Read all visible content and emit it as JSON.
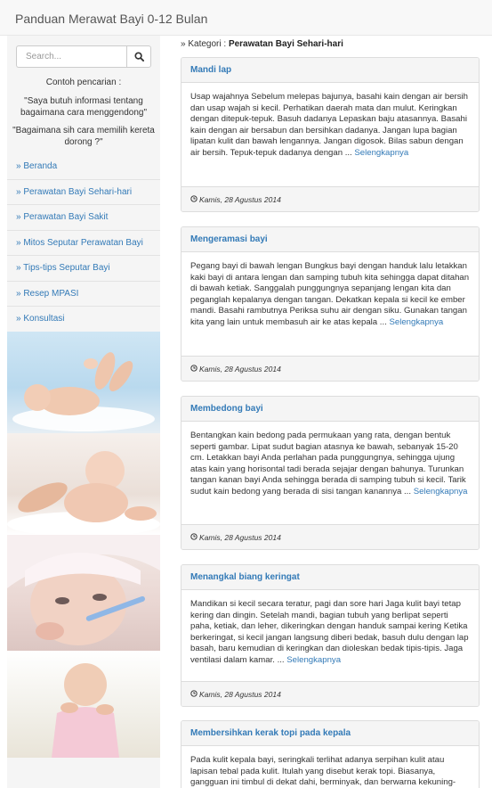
{
  "brand": "Panduan Merawat Bayi 0-12 Bulan",
  "search": {
    "placeholder": "Search...",
    "hint_title": "Contoh pencarian :",
    "examples": [
      "\"Saya butuh informasi tentang bagaimana cara menggendong\"",
      "\"Bagaimana sih cara memilih kereta dorong ?\""
    ]
  },
  "sidebar": {
    "items": [
      "» Beranda",
      "» Perawatan Bayi Sehari-hari",
      "» Perawatan Bayi Sakit",
      "» Mitos Seputar Perawatan Bayi",
      "» Tips-tips Seputar Bayi",
      "» Resep MPASI",
      "» Konsultasi"
    ]
  },
  "breadcrumb": {
    "prefix": "» Kategori :",
    "category": "Perawatan Bayi Sehari-hari"
  },
  "articles": [
    {
      "title": "Mandi lap",
      "excerpt": "Usap wajahnya Sebelum melepas bajunya, basahi kain dengan air bersih dan usap wajah si kecil. Perhatikan daerah mata dan mulut. Keringkan dengan ditepuk-tepuk. Basuh dadanya Lepaskan baju atasannya. Basahi kain dengan air bersabun dan bersihkan dadanya. Jangan lupa bagian lipatan kulit dan bawah lengannya. Jangan digosok. Bilas sabun dengan air bersih. Tepuk-tepuk dadanya dengan ...",
      "more": "Selengkapnya",
      "date": "Kamis, 28 Agustus 2014"
    },
    {
      "title": "Mengeramasi bayi",
      "excerpt": "Pegang bayi di bawah lengan Bungkus bayi dengan handuk lalu letakkan kaki bayi di antara lengan dan samping tubuh kita sehingga dapat ditahan di bawah ketiak. Sanggalah punggungnya sepanjang lengan kita dan peganglah kepalanya dengan tangan. Dekatkan kepala si kecil ke ember mandi. Basahi rambutnya Periksa suhu air dengan siku. Gunakan tangan kita yang lain untuk membasuh air ke atas kepala ...",
      "more": "Selengkapnya",
      "date": "Kamis, 28 Agustus 2014"
    },
    {
      "title": "Membedong bayi",
      "excerpt": "Bentangkan kain bedong pada permukaan yang rata, dengan bentuk seperti gambar. Lipat sudut bagian atasnya ke bawah, sebanyak 15-20 cm. Letakkan bayi Anda perlahan pada punggungnya, sehingga ujung atas kain yang horisontal tadi berada sejajar dengan bahunya. Turunkan tangan kanan bayi Anda sehingga berada di samping tubuh si kecil. Tarik sudut kain bedong yang berada di sisi tangan kanannya ...",
      "more": "Selengkapnya",
      "date": "Kamis, 28 Agustus 2014"
    },
    {
      "title": "Menangkal biang keringat",
      "excerpt": "Mandikan si kecil secara teratur, pagi dan sore hari Jaga kulit bayi tetap kering dan dingin. Setelah mandi, bagian tubuh yang berlipat seperti paha, ketiak, dan leher, dikeringkan dengan handuk sampai kering Ketika berkeringat, si kecil jangan langsung diberi bedak, basuh dulu dengan lap basah, baru kemudian di keringkan dan dioleskan bedak tipis-tipis. Jaga ventilasi dalam kamar. ...",
      "more": "Selengkapnya",
      "date": "Kamis, 28 Agustus 2014"
    },
    {
      "title": "Membersihkan kerak topi pada kepala",
      "excerpt": "Pada kulit kepala bayi, seringkali terlihat adanya serpihan kulit atau lapisan tebal pada kulit. Itulah yang disebut kerak topi. Biasanya, gangguan ini timbul di dekat dahi, berminyak, dan berwarna kekuning-",
      "more": "",
      "date": ""
    }
  ],
  "icons": {
    "search": "search-icon",
    "clock": "clock-icon"
  },
  "colors": {
    "link": "#337ab7",
    "panel_heading_bg": "#f5f5f5",
    "border": "#dddddd",
    "navbar_bg": "#f8f8f8"
  }
}
